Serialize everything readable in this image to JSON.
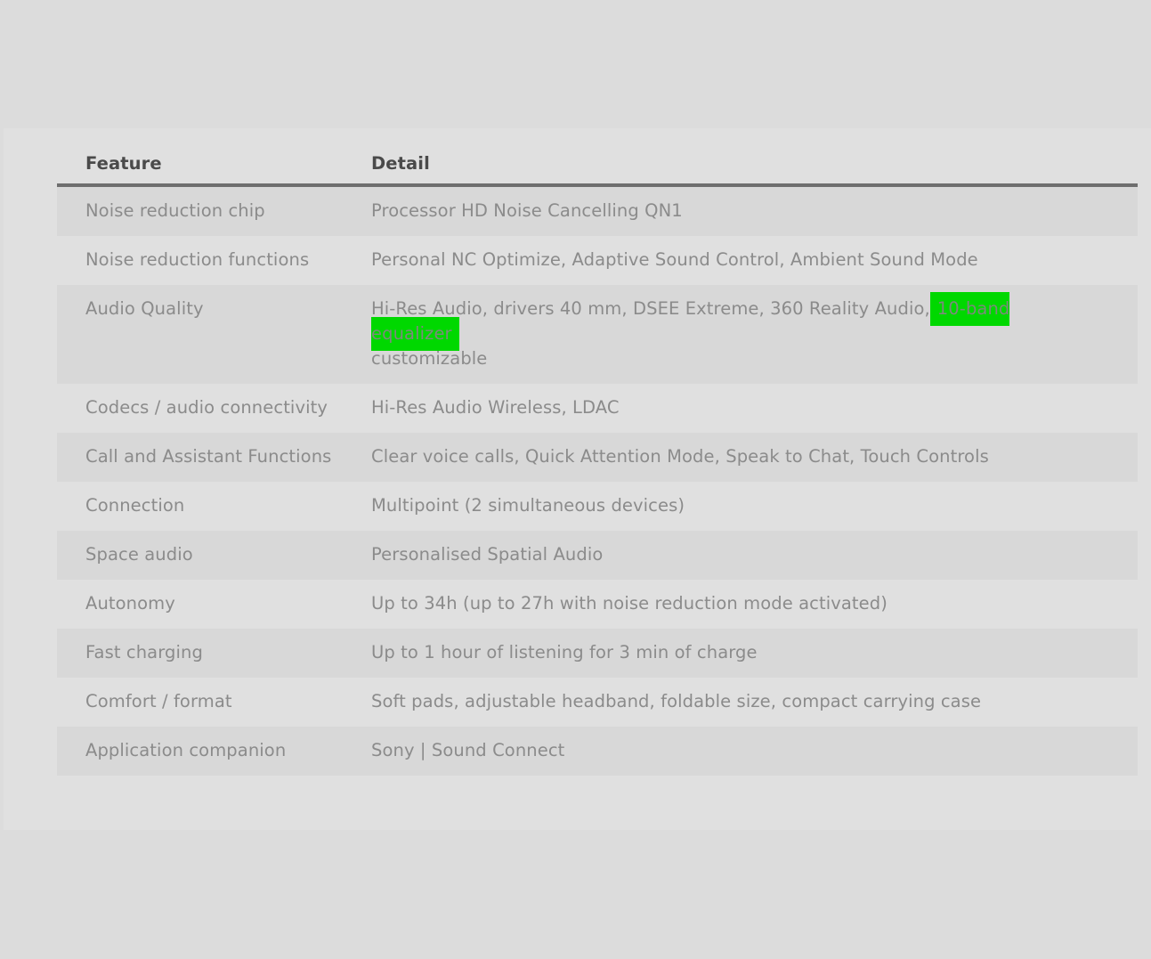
{
  "table": {
    "header": {
      "feature": "Feature",
      "detail": "Detail"
    },
    "rows": [
      {
        "feature": "Noise reduction chip",
        "detail": "Processor HD Noise Cancelling QN1"
      },
      {
        "feature": "Noise reduction functions",
        "detail": "Personal NC Optimize, Adaptive Sound Control, Ambient Sound Mode"
      },
      {
        "feature": "Audio Quality",
        "detail_before": "Hi-Res Audio, drivers 40 mm, DSEE Extreme, 360 Reality Audio,",
        "detail_highlight": "10-band equalizer",
        "detail_after": "customizable"
      },
      {
        "feature": "Codecs / audio connectivity",
        "detail": "Hi-Res Audio Wireless, LDAC"
      },
      {
        "feature": "Call and Assistant Functions",
        "detail": "Clear voice calls, Quick Attention Mode, Speak to Chat, Touch Controls"
      },
      {
        "feature": "Connection",
        "detail": "Multipoint (2 simultaneous devices)"
      },
      {
        "feature": "Space audio",
        "detail": "Personalised Spatial Audio"
      },
      {
        "feature": "Autonomy",
        "detail": "Up to 34h (up to 27h with noise reduction mode activated)"
      },
      {
        "feature": "Fast charging",
        "detail": "Up to 1 hour of listening for 3 min of charge"
      },
      {
        "feature": "Comfort / format",
        "detail": "Soft pads, adjustable headband, foldable size, compact carrying case"
      },
      {
        "feature": "Application companion",
        "detail": "Sony | Sound Connect"
      }
    ]
  },
  "colors": {
    "highlight": "#00d800",
    "header_text": "#4a4a4a",
    "body_text": "#8b8b8b",
    "header_rule": "#6e6e6e"
  }
}
